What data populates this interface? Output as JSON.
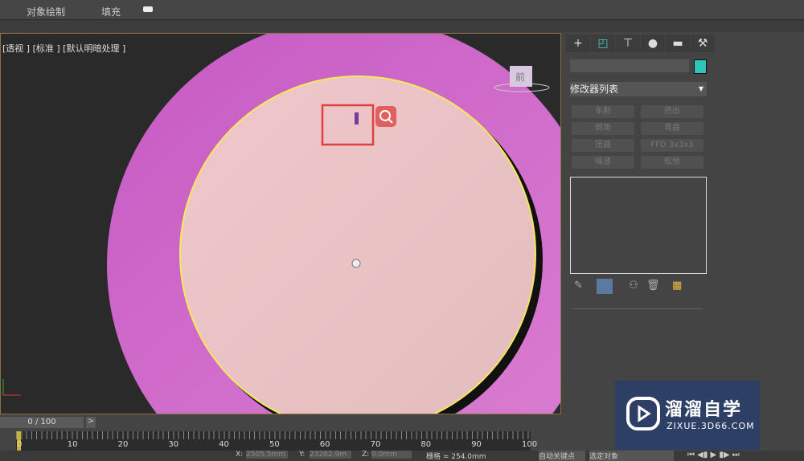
{
  "menu": {
    "object_paint": "对象绘制",
    "fill": "填充"
  },
  "viewport": {
    "label": "[透视 ] [标准 ] [默认明暗处理 ]",
    "gizmo_label": "前"
  },
  "panel": {
    "tabs": [
      "+",
      "modify",
      "hierarchy",
      "motion",
      "display",
      "utilities"
    ],
    "name_value": "",
    "color": "#2ec4b6",
    "modifier_list": "修改器列表",
    "buttons": [
      "车削",
      "挤出",
      "倒角",
      "弯曲",
      "扭曲",
      "FFD 3x3x3",
      "噪波",
      "松弛"
    ]
  },
  "timeline": {
    "frame": "0 / 100",
    "next": ">",
    "ticks": [
      "0",
      "10",
      "20",
      "30",
      "40",
      "50",
      "60",
      "70",
      "80",
      "90",
      "100"
    ]
  },
  "status": {
    "x_label": "X:",
    "x_value": "2505.5mm",
    "y_label": "Y:",
    "y_value": "23282.9m",
    "z_label": "Z:",
    "z_value": "0.0mm",
    "grid": "栅格 = 254.0mm",
    "auto_key": "自动关键点",
    "selected": "选定对象"
  },
  "watermark": {
    "name": "溜溜自学",
    "url": "ZIXUE.3D66.COM"
  }
}
